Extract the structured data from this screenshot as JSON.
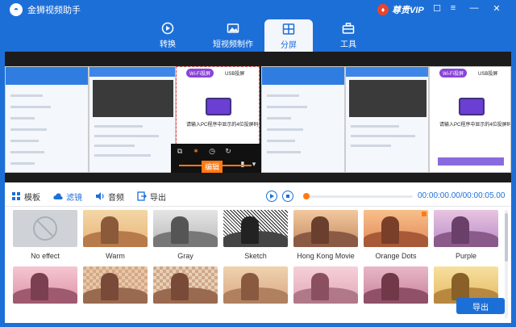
{
  "app": {
    "title": "金狮视频助手",
    "vip_label": "尊贵VIP"
  },
  "window_controls": [
    "☐",
    "≡",
    "—",
    "✕"
  ],
  "nav": {
    "tabs": [
      {
        "label": "转换",
        "icon": "convert-icon"
      },
      {
        "label": "短视频制作",
        "icon": "short-video-icon"
      },
      {
        "label": "分屏",
        "icon": "split-screen-icon",
        "active": true
      },
      {
        "label": "工具",
        "icon": "toolbox-icon"
      }
    ]
  },
  "preview": {
    "right_card_caption": "请输入PC程序中显示的4位投屏码",
    "wifi_badge": "Wi-Fi投屏",
    "usb_badge": "USB投屏",
    "edit_label": "编辑"
  },
  "editor_tabs": [
    {
      "label": "模板",
      "icon": "template-icon"
    },
    {
      "label": "滤镜",
      "icon": "cloud-filter-icon",
      "active": true
    },
    {
      "label": "音频",
      "icon": "audio-icon"
    },
    {
      "label": "导出",
      "icon": "export-icon"
    }
  ],
  "player": {
    "time": "00:00:00.00/00:00:05.00",
    "progress": 0.0
  },
  "filters": [
    {
      "label": "No effect",
      "style": "none"
    },
    {
      "label": "Warm",
      "style": "warm"
    },
    {
      "label": "Gray",
      "style": "gray"
    },
    {
      "label": "Sketch",
      "style": "sketch"
    },
    {
      "label": "Hong Kong Movie",
      "style": "hk"
    },
    {
      "label": "Orange Dots",
      "style": "orange"
    },
    {
      "label": "Purple",
      "style": "purple"
    },
    {
      "label": "",
      "style": "pink"
    },
    {
      "label": "",
      "style": "mosaic"
    },
    {
      "label": "",
      "style": "mosaic2"
    },
    {
      "label": "",
      "style": "blur"
    },
    {
      "label": "",
      "style": "pinkhaze"
    },
    {
      "label": "",
      "style": "rose"
    },
    {
      "label": "",
      "style": "gold"
    }
  ],
  "export_button": "导出",
  "colors": {
    "primary": "#1d6fd8",
    "accent": "#ff7a14",
    "vip": "#e8452e"
  }
}
